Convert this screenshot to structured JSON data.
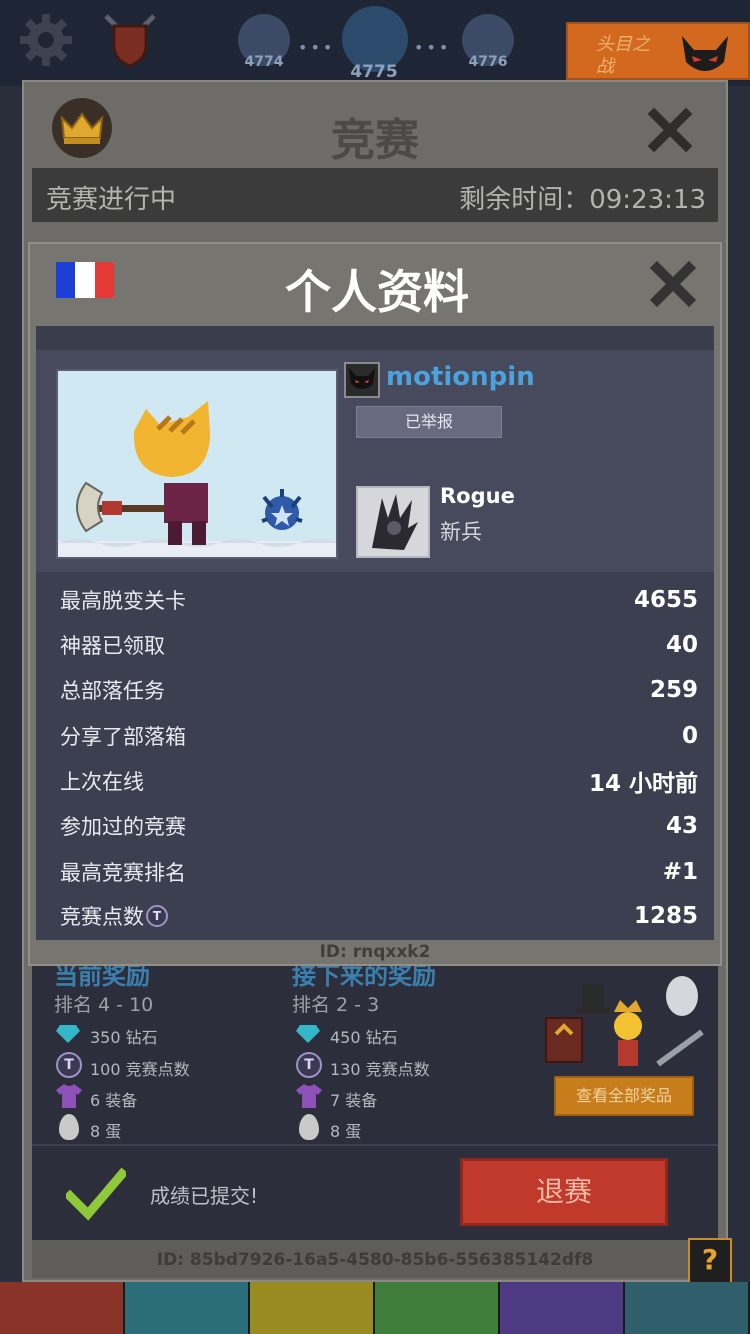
{
  "hud": {
    "stages": [
      "4774",
      "4775",
      "4776"
    ],
    "boss_label": "头目之战"
  },
  "contest": {
    "title": "竞赛",
    "status": "竞赛进行中",
    "time_label": "剩余时间：",
    "time_value": "09:23:13",
    "current_rewards": {
      "heading": "当前奖励",
      "rank": "排名 4 - 10",
      "items": [
        "350 钻石",
        "100 竞赛点数",
        "6 装备",
        "8 蛋"
      ]
    },
    "next_rewards": {
      "heading": "接下来的奖励",
      "rank": "排名 2 - 3",
      "items": [
        "450 钻石",
        "130 竞赛点数",
        "7 装备",
        "8 蛋"
      ]
    },
    "view_all_label": "查看全部奖品",
    "submitted_label": "成绩已提交!",
    "quit_label": "退赛",
    "contest_id": "ID: 85bd7926-16a5-4580-85b6-556385142df8",
    "help_label": "?"
  },
  "profile": {
    "title": "个人资料",
    "flag_colors": [
      "#1c3fd6",
      "#ffffff",
      "#e53935"
    ],
    "username": "motionpin",
    "reported_label": "已举报",
    "class_name": "Rogue",
    "class_rank": "新兵",
    "stats": [
      {
        "label": "最高脱变关卡",
        "value": "4655"
      },
      {
        "label": "神器已领取",
        "value": "40"
      },
      {
        "label": "总部落任务",
        "value": "259"
      },
      {
        "label": "分享了部落箱",
        "value": "0"
      },
      {
        "label": "上次在线",
        "value": "14 小时前"
      },
      {
        "label": "参加过的竞赛",
        "value": "43"
      },
      {
        "label": "最高竞赛排名",
        "value": "#1"
      },
      {
        "label": "竞赛点数",
        "value": "1285"
      }
    ],
    "token_glyph": "T",
    "player_id": "ID: rnqxxk2"
  },
  "colors": {
    "username": "#4ba3de",
    "quit_button": "#c0392b",
    "view_all_button": "#c87d1d",
    "check": "#8fc93a"
  },
  "icons": {
    "settings": "gear-icon",
    "clan": "shield-icon",
    "close": "close-icon",
    "crown": "crown-icon",
    "gem": "diamond-icon",
    "token": "contest-token-icon",
    "equipment": "shirt-icon",
    "egg": "egg-icon",
    "submitted": "checkmark-icon"
  }
}
